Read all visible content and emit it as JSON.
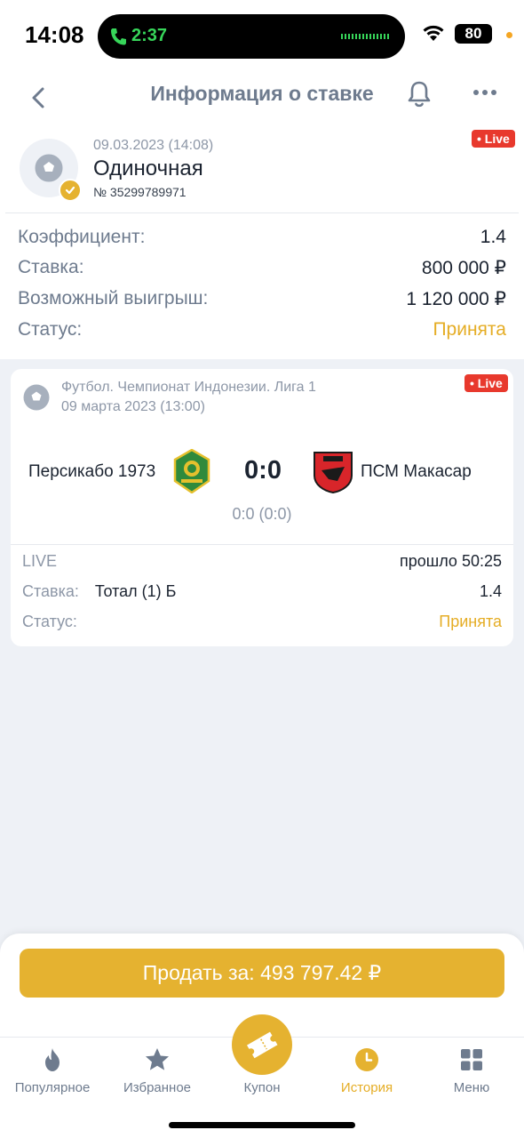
{
  "status_bar": {
    "time": "14:08",
    "call_timer": "2:37",
    "battery": "80"
  },
  "header": {
    "title": "Информация о ставке",
    "icons": [
      "back-arrow-icon",
      "bell-icon",
      "more-icon"
    ]
  },
  "bet": {
    "date": "09.03.2023 (14:08)",
    "type": "Одиночная",
    "number": "№ 35299789971",
    "live_badge": "• Live",
    "rows": [
      {
        "label": "Коэффициент:",
        "value": "1.4"
      },
      {
        "label": "Ставка:",
        "value": "800 000 ₽"
      },
      {
        "label": "Возможный выигрыш:",
        "value": "1 120 000 ₽"
      },
      {
        "label": "Статус:",
        "value": "Принята"
      }
    ]
  },
  "event": {
    "league": "Футбол. Чемпионат Индонезии. Лига 1",
    "date": "09 марта 2023 (13:00)",
    "live_badge": "• Live",
    "team1": "Персикабо 1973",
    "team2": "ПСМ Макасар",
    "score": "0:0",
    "score_detail": "0:0 (0:0)",
    "live_label": "LIVE",
    "elapsed": "прошло 50:25",
    "stake_label": "Ставка:",
    "stake_market": "Тотал (1) Б",
    "stake_coef": "1.4",
    "status_label": "Статус:",
    "status_value": "Принята"
  },
  "sell": {
    "label": "Продать за: 493 797.42 ₽"
  },
  "nav": {
    "items": [
      {
        "label": "Популярное",
        "icon": "flame-icon"
      },
      {
        "label": "Избранное",
        "icon": "star-icon"
      },
      {
        "label": "Купон",
        "icon": "ticket-icon"
      },
      {
        "label": "История",
        "icon": "clock-icon"
      },
      {
        "label": "Меню",
        "icon": "grid-icon"
      }
    ]
  },
  "colors": {
    "accent": "#e5b230",
    "live": "#e8392d",
    "muted": "#6e7b8e",
    "background": "#eef1f6"
  }
}
